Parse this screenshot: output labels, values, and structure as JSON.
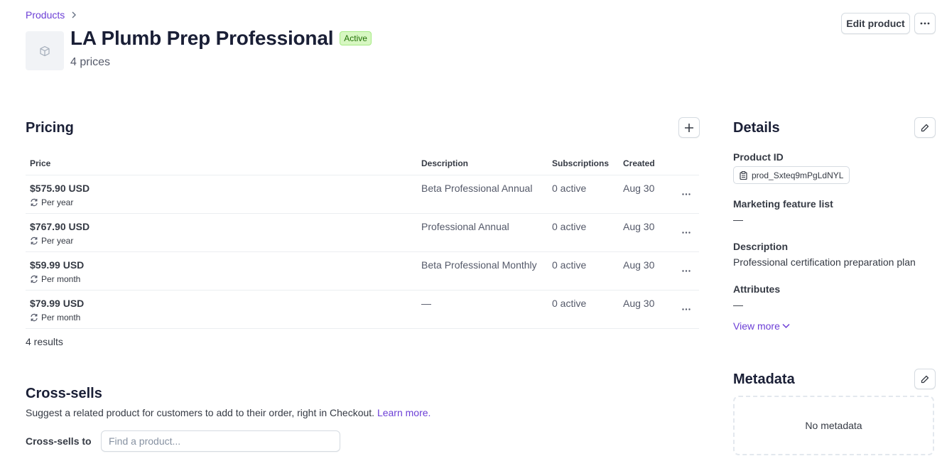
{
  "breadcrumb": {
    "label": "Products"
  },
  "product": {
    "title": "LA Plumb Prep Professional",
    "status": "Active",
    "subtitle": "4 prices"
  },
  "header_actions": {
    "edit_label": "Edit product"
  },
  "pricing": {
    "title": "Pricing",
    "columns": [
      "Price",
      "Description",
      "Subscriptions",
      "Created"
    ],
    "rows": [
      {
        "amount": "$575.90 USD",
        "interval": "Per year",
        "description": "Beta Professional Annual",
        "subscriptions": "0 active",
        "created": "Aug 30"
      },
      {
        "amount": "$767.90 USD",
        "interval": "Per year",
        "description": "Professional Annual",
        "subscriptions": "0 active",
        "created": "Aug 30"
      },
      {
        "amount": "$59.99 USD",
        "interval": "Per month",
        "description": "Beta Professional Monthly",
        "subscriptions": "0 active",
        "created": "Aug 30"
      },
      {
        "amount": "$79.99 USD",
        "interval": "Per month",
        "description": "—",
        "subscriptions": "0 active",
        "created": "Aug 30"
      }
    ],
    "results": "4 results"
  },
  "cross_sells": {
    "title": "Cross-sells",
    "description": "Suggest a related product for customers to add to their order, right in Checkout.",
    "learn_more": "Learn more.",
    "label": "Cross-sells to",
    "placeholder": "Find a product..."
  },
  "details": {
    "title": "Details",
    "product_id_label": "Product ID",
    "product_id": "prod_Sxteq9mPgLdNYL",
    "marketing_label": "Marketing feature list",
    "marketing_value": "—",
    "description_label": "Description",
    "description_value": "Professional certification preparation plan",
    "attributes_label": "Attributes",
    "attributes_value": "—",
    "view_more": "View more"
  },
  "metadata": {
    "title": "Metadata",
    "empty": "No metadata"
  },
  "colors": {
    "accent": "#6c3fd6",
    "badge_bg": "#d7f7c2",
    "badge_text": "#217005"
  },
  "icons": [
    "chevron-right-icon",
    "box-icon",
    "more-horizontal-icon",
    "plus-icon",
    "refresh-icon",
    "pencil-icon",
    "clipboard-icon",
    "chevron-down-icon"
  ]
}
